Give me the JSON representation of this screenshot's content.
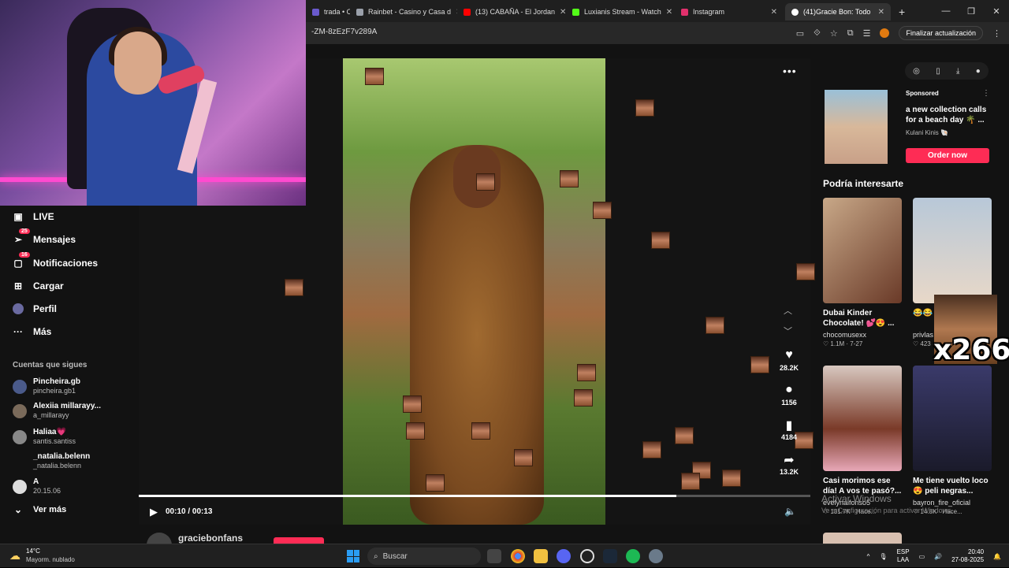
{
  "browser": {
    "tabs": [
      {
        "label": "trada • C",
        "color": "#6a5acd",
        "active": false
      },
      {
        "label": "Rainbet - Casino y Casa d",
        "color": "#9aa0aa",
        "active": false
      },
      {
        "label": "(13) CABAÑA - El Jordan",
        "color": "#ff0000",
        "active": false
      },
      {
        "label": "Luxianis Stream - Watch",
        "color": "#53fc18",
        "active": false
      },
      {
        "label": "Instagram",
        "color": "#e1306c",
        "active": false
      },
      {
        "label": "(41)Gracie Bon: Todo",
        "color": "#ffffff",
        "active": true
      }
    ],
    "new_tab": "+",
    "url": "-ZM-8zEzF7v289A",
    "update_button": "Finalizar actualización",
    "window_controls": [
      "—",
      "❐",
      "✕"
    ]
  },
  "sidebar": {
    "nav": [
      {
        "label": "LIVE",
        "icon": "live-icon",
        "glyph": "▣",
        "badge": ""
      },
      {
        "label": "Mensajes",
        "icon": "messages-icon",
        "glyph": "➢",
        "badge": "25"
      },
      {
        "label": "Notificaciones",
        "icon": "notifications-icon",
        "glyph": "▢",
        "badge": "16"
      },
      {
        "label": "Cargar",
        "icon": "upload-icon",
        "glyph": "⊞",
        "badge": ""
      },
      {
        "label": "Perfil",
        "icon": "profile-icon",
        "glyph": "●",
        "badge": ""
      },
      {
        "label": "Más",
        "icon": "more-icon",
        "glyph": "···",
        "badge": ""
      }
    ],
    "following_title": "Cuentas que sigues",
    "following": [
      {
        "name": "Pincheira.gb",
        "handle": "pincheira.gb1"
      },
      {
        "name": "Alexiia millarayy...",
        "handle": "a_millarayy"
      },
      {
        "name": "Haliaa💗",
        "handle": "santis.santiss"
      },
      {
        "name": "_natalia.belenn",
        "handle": "_natalia.belenn"
      },
      {
        "name": "A",
        "handle": "20.15.06"
      }
    ],
    "see_more": "Ver más"
  },
  "video": {
    "time": "00:10 / 00:13",
    "progress": 0.8,
    "author": "graciebonfans",
    "actions": [
      {
        "icon": "heart-icon",
        "glyph": "♥",
        "count": "28.2K"
      },
      {
        "icon": "comment-icon",
        "glyph": "💬",
        "count": "1156"
      },
      {
        "icon": "bookmark-icon",
        "glyph": "🔖",
        "count": "4184"
      },
      {
        "icon": "share-icon",
        "glyph": "➦",
        "count": "13.2K"
      }
    ],
    "more": "•••"
  },
  "right": {
    "sponsored_label": "Sponsored",
    "ad_text": "a new collection calls for a beach day 🌴 ...",
    "ad_brand": "Kulani Kinis 🐚",
    "order_button": "Order now",
    "recommend_title": "Podría interesarte",
    "cards": [
      {
        "title": "Dubai Kinder Chocolate! 💕😍 ...",
        "user": "chocomusexx",
        "stats": "♡ 1.1M · 7-27",
        "color": "#8a5a40"
      },
      {
        "title": "😂😂",
        "user": "privlas",
        "stats": "♡ 423",
        "color": "#c8b8a8"
      },
      {
        "title": "Casi morimos ese día! A vos te pasó?...",
        "user": "evelynalfonso5",
        "stats": "♡ 131.7K · Hace...",
        "color": "#7a4030"
      },
      {
        "title": "Me tiene vuelto loco 😍 peli negras...",
        "user": "bayron_fire_oficial",
        "stats": "♡ 14.8K · Hace...",
        "color": "#2a2a4a"
      }
    ],
    "overlay_counter": "x266",
    "watermark_title": "Activar Windows",
    "watermark_sub": "Ve a Configuración para activar Windows."
  },
  "taskbar": {
    "temp": "14°C",
    "weather": "Mayorm. nublado",
    "search_placeholder": "Buscar",
    "lang_top": "ESP",
    "lang_bottom": "LAA",
    "time": "20:40",
    "date": "27-08-2025"
  }
}
